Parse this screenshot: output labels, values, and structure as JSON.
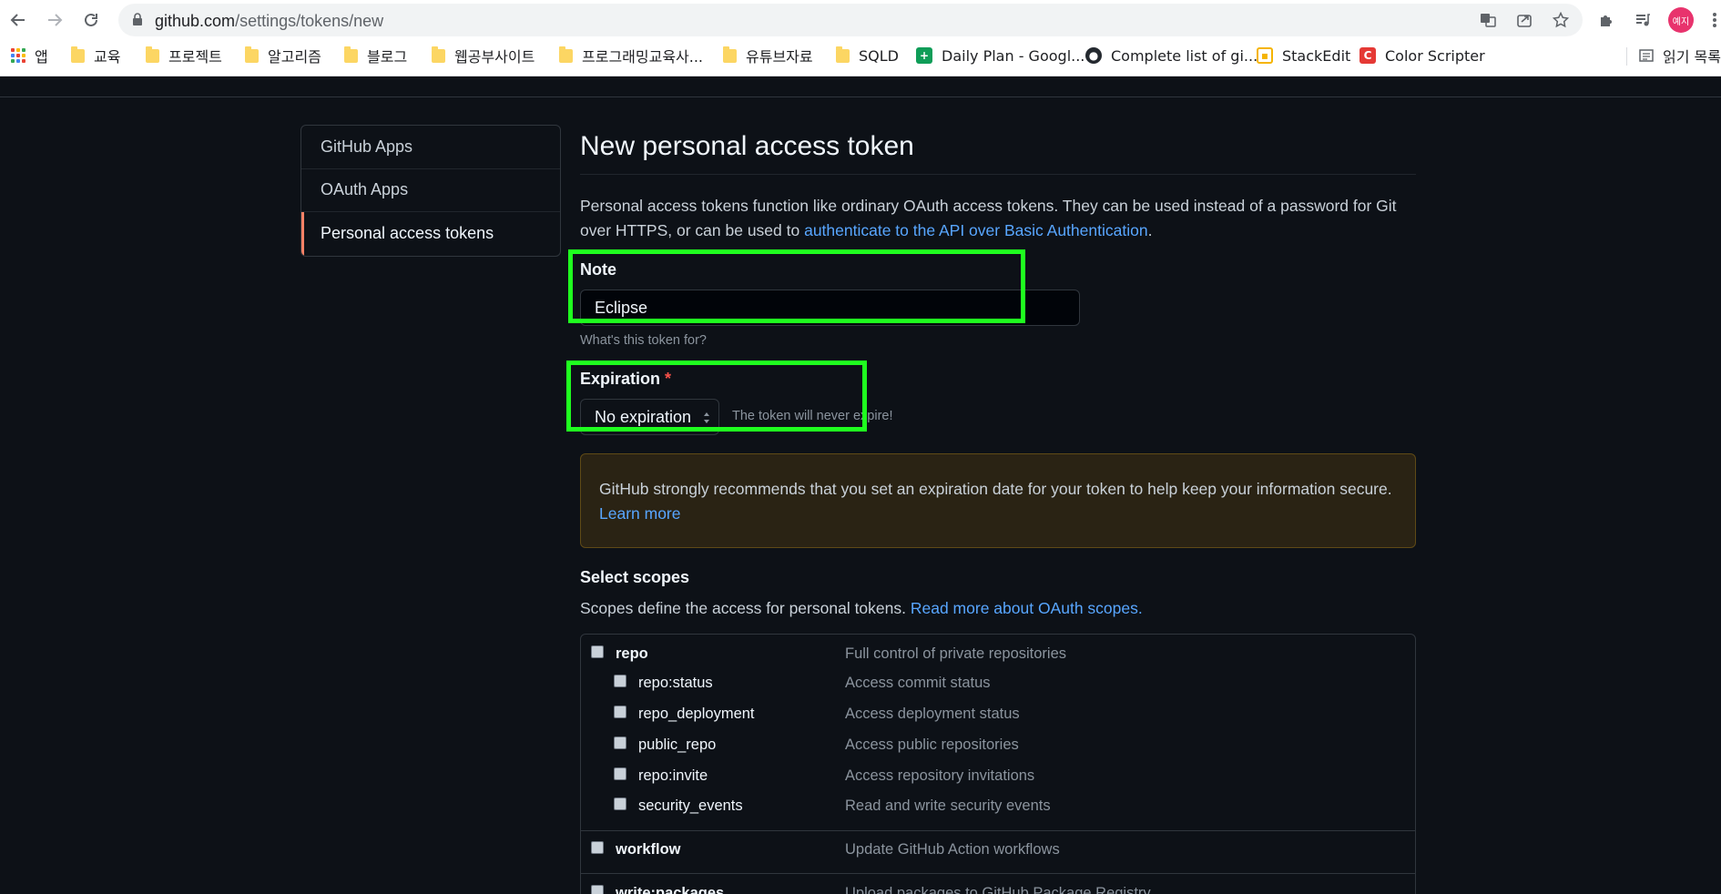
{
  "browser": {
    "url_host": "github.com",
    "url_path": "/settings/tokens/new",
    "profile_label": "예지",
    "bookmarks": [
      {
        "label": "앱",
        "icon": "apps-grid-icon"
      },
      {
        "label": "교육",
        "icon": "folder-icon"
      },
      {
        "label": "프로젝트",
        "icon": "folder-icon"
      },
      {
        "label": "알고리즘",
        "icon": "folder-icon"
      },
      {
        "label": "블로그",
        "icon": "folder-icon"
      },
      {
        "label": "웹공부사이트",
        "icon": "folder-icon"
      },
      {
        "label": "프로그래밍교육사...",
        "icon": "folder-icon"
      },
      {
        "label": "유튜브자료",
        "icon": "folder-icon"
      },
      {
        "label": "SQLD",
        "icon": "folder-icon"
      },
      {
        "label": "Daily Plan - Googl...",
        "icon": "google-sheets-icon"
      },
      {
        "label": "Complete list of gi...",
        "icon": "github-icon"
      },
      {
        "label": "StackEdit",
        "icon": "stackedit-icon"
      },
      {
        "label": "Color Scripter",
        "icon": "color-scripter-icon"
      },
      {
        "label": "읽기 목록",
        "icon": "reading-list-icon"
      }
    ]
  },
  "sidebar": {
    "items": [
      {
        "label": "GitHub Apps"
      },
      {
        "label": "OAuth Apps"
      },
      {
        "label": "Personal access tokens",
        "active": true
      }
    ]
  },
  "main": {
    "title": "New personal access token",
    "intro_text": "Personal access tokens function like ordinary OAuth access tokens. They can be used instead of a password for Git over HTTPS, or can be used to ",
    "intro_link": "authenticate to the API over Basic Authentication",
    "intro_end": ".",
    "note": {
      "label": "Note",
      "value": "Eclipse",
      "hint": "What's this token for?"
    },
    "expiration": {
      "label": "Expiration",
      "required_mark": "*",
      "selected": "No expiration",
      "hint": "The token will never expire!"
    },
    "flash": {
      "text": "GitHub strongly recommends that you set an expiration date for your token to help keep your information secure. ",
      "link": "Learn more"
    },
    "scopes": {
      "title": "Select scopes",
      "desc": "Scopes define the access for personal tokens. ",
      "desc_link": "Read more about OAuth scopes.",
      "items": [
        {
          "name": "repo",
          "desc": "Full control of private repositories",
          "level": 0
        },
        {
          "name": "repo:status",
          "desc": "Access commit status",
          "level": 1
        },
        {
          "name": "repo_deployment",
          "desc": "Access deployment status",
          "level": 1
        },
        {
          "name": "public_repo",
          "desc": "Access public repositories",
          "level": 1
        },
        {
          "name": "repo:invite",
          "desc": "Access repository invitations",
          "level": 1
        },
        {
          "name": "security_events",
          "desc": "Read and write security events",
          "level": 1
        },
        {
          "name": "workflow",
          "desc": "Update GitHub Action workflows",
          "level": 0
        },
        {
          "name": "write:packages",
          "desc": "Upload packages to GitHub Package Registry",
          "level": 0
        }
      ]
    }
  },
  "colors": {
    "highlight": "#1fff1f",
    "link": "#58a6ff",
    "active_accent": "#f78166",
    "background": "#0d1117"
  }
}
